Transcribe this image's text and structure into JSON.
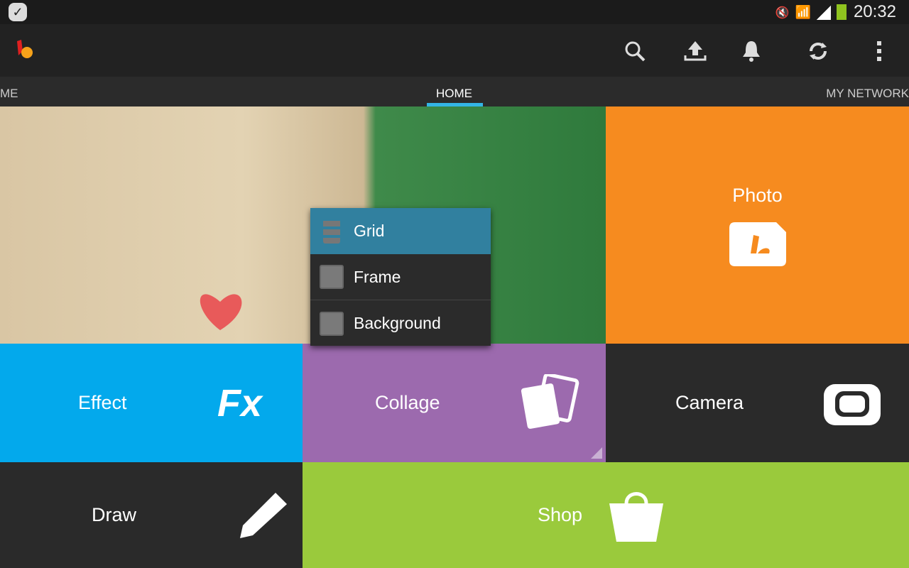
{
  "status": {
    "time": "20:32",
    "icons": [
      "check-notification-icon",
      "mute-icon",
      "wifi-icon",
      "signal-icon",
      "battery-icon"
    ]
  },
  "actionbar": {
    "icons": [
      "search-icon",
      "upload-icon",
      "bell-icon",
      "sync-icon",
      "overflow-menu-icon"
    ]
  },
  "tabs": {
    "left": "ME",
    "active": "HOME",
    "right": "MY NETWORK"
  },
  "tiles": {
    "photo": "Photo",
    "effect": "Effect",
    "collage": "Collage",
    "camera": "Camera",
    "draw": "Draw",
    "shop": "Shop"
  },
  "menu": {
    "items": [
      {
        "label": "Grid",
        "icon": "grid-icon",
        "selected": true
      },
      {
        "label": "Frame",
        "icon": "frame-icon"
      },
      {
        "label": "Background",
        "icon": "background-icon"
      }
    ]
  },
  "colors": {
    "photo": "#f68b1f",
    "effect": "#03a9ec",
    "collage": "#9c6aae",
    "shop": "#9aca3c",
    "accent": "#33b5e5",
    "menu_selected": "#31809f"
  }
}
